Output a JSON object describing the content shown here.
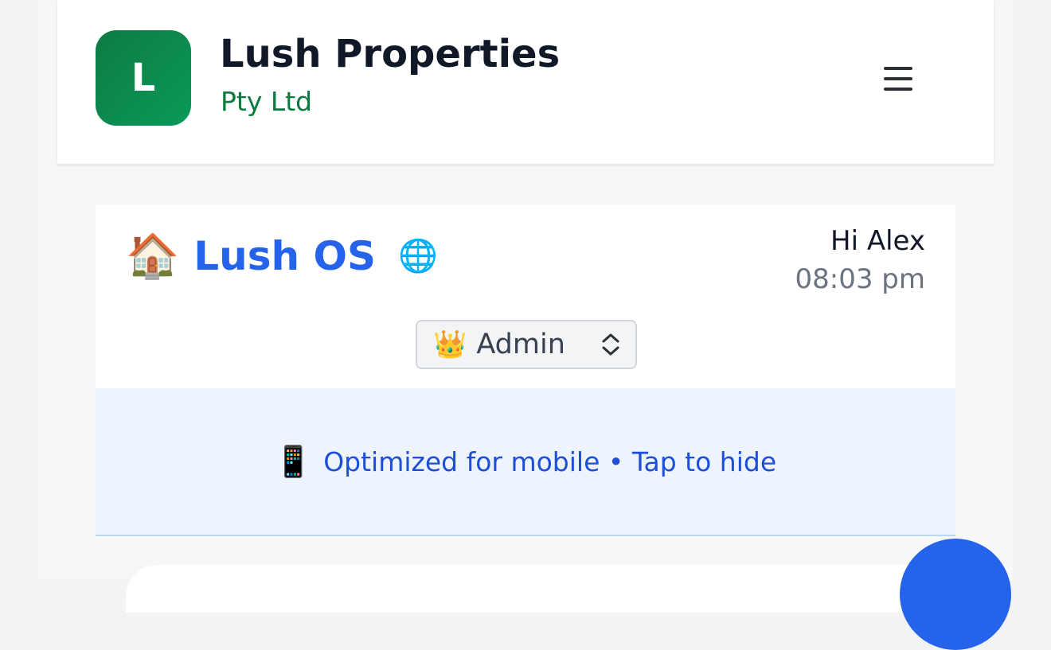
{
  "header": {
    "logo_letter": "L",
    "brand_name": "Lush Properties",
    "brand_sub": "Pty Ltd",
    "menu_icon": "hamburger-menu-icon"
  },
  "app": {
    "house_icon": "🏠",
    "name": "Lush OS",
    "globe_icon": "🌐",
    "greeting": "Hi Alex",
    "time": "08:03 pm"
  },
  "role_select": {
    "crown_icon": "👑",
    "selected": "Admin"
  },
  "banner": {
    "phone_icon": "📱",
    "text": "Optimized for mobile • Tap to hide"
  },
  "colors": {
    "brand_green": "#0d7a44",
    "accent_blue": "#2563eb",
    "banner_bg": "#eef4fd"
  }
}
